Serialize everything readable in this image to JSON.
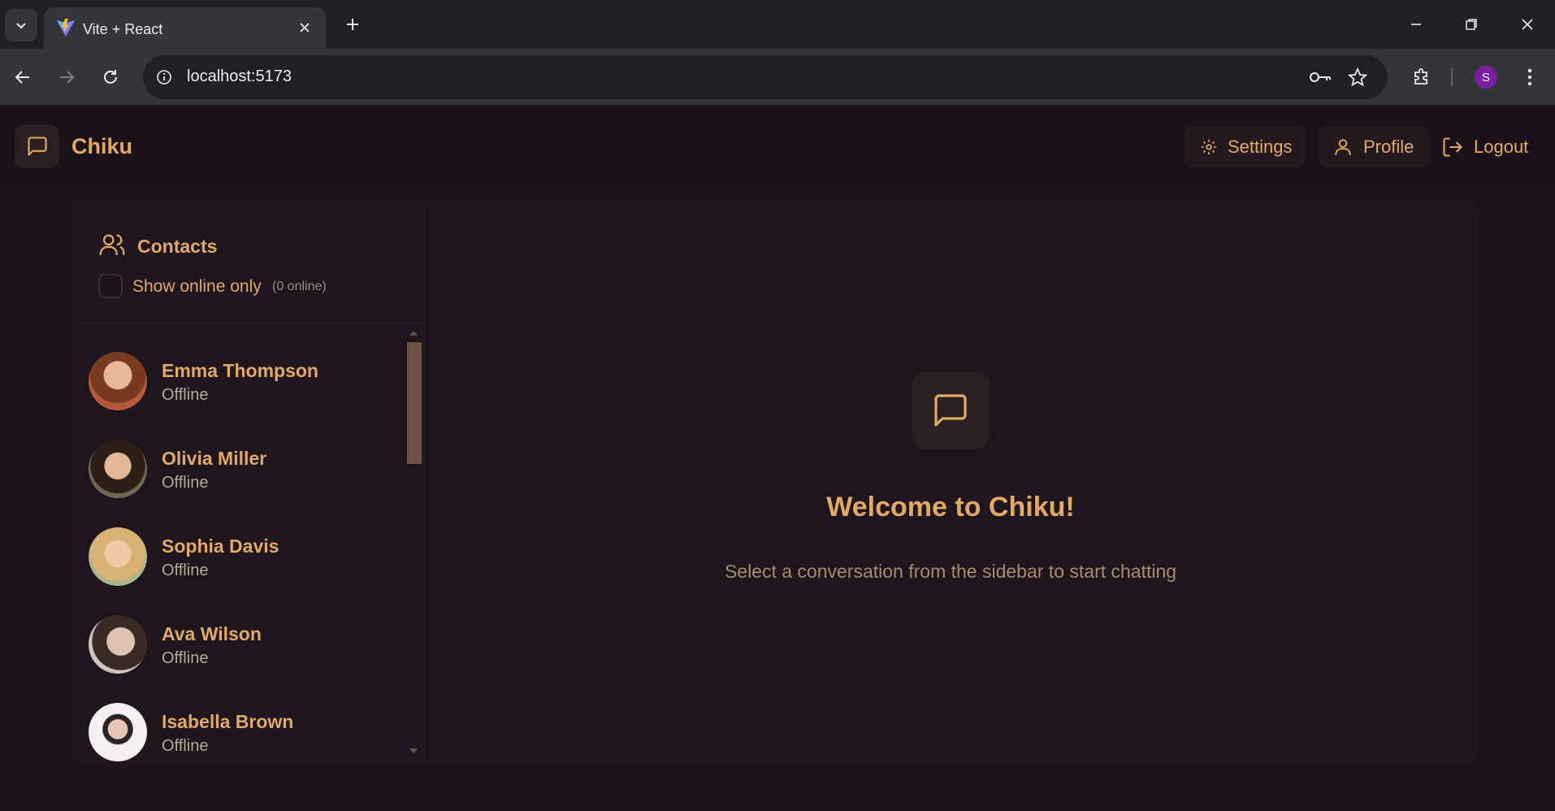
{
  "browser": {
    "tab_title": "Vite + React",
    "url": "localhost:5173",
    "profile_initial": "S"
  },
  "app": {
    "brand": "Chiku",
    "nav": {
      "settings": "Settings",
      "profile": "Profile",
      "logout": "Logout"
    }
  },
  "sidebar": {
    "title": "Contacts",
    "online_filter_label": "Show online only",
    "online_count": "(0 online)",
    "contacts": [
      {
        "name": "Emma Thompson",
        "status": "Offline"
      },
      {
        "name": "Olivia Miller",
        "status": "Offline"
      },
      {
        "name": "Sophia Davis",
        "status": "Offline"
      },
      {
        "name": "Ava Wilson",
        "status": "Offline"
      },
      {
        "name": "Isabella Brown",
        "status": "Offline"
      }
    ]
  },
  "welcome": {
    "title": "Welcome to Chiku!",
    "subtitle": "Select a conversation from the sidebar to start chatting"
  },
  "colors": {
    "accent": "#e0a965",
    "background": "#1d141c"
  }
}
